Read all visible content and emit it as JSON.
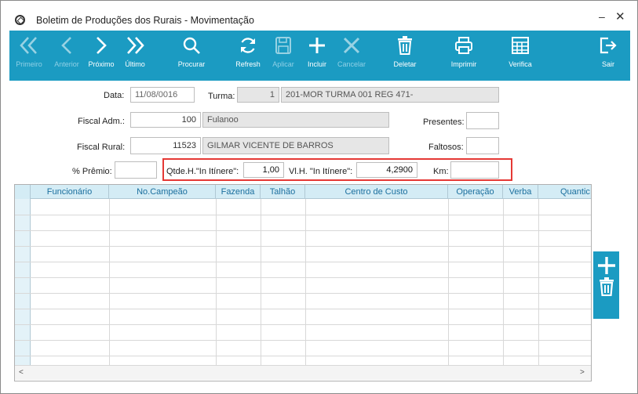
{
  "window": {
    "title": "Boletim de Produções dos Rurais - Movimentação"
  },
  "toolbar": {
    "first": "Primeiro",
    "previous": "Anterior",
    "next": "Próximo",
    "last": "Último",
    "search": "Procurar",
    "refresh": "Refresh",
    "apply": "Aplicar",
    "include": "Incluir",
    "cancel": "Cancelar",
    "delete": "Deletar",
    "print": "Imprimir",
    "verify": "Verifica",
    "exit": "Sair"
  },
  "form": {
    "data_label": "Data:",
    "data_value": "11/08/0016",
    "turma_label": "Turma:",
    "turma_code": "1",
    "turma_desc": "201-MOR TURMA 001 REG 471-",
    "fiscal_adm_label": "Fiscal Adm.:",
    "fiscal_adm_code": "100",
    "fiscal_adm_name": "Fulanoo",
    "presentes_label": "Presentes:",
    "presentes_value": "",
    "fiscal_rural_label": "Fiscal Rural:",
    "fiscal_rural_code": "11523",
    "fiscal_rural_name": "GILMAR VICENTE DE BARROS",
    "faltosos_label": "Faltosos:",
    "faltosos_value": "",
    "premio_label": "% Prêmio:",
    "premio_value": "",
    "qtde_label": "Qtde.H.\"In Itínere\":",
    "qtde_value": "1,00",
    "vlh_label": "Vl.H. \"In Itínere\":",
    "vlh_value": "4,2900",
    "km_label": "Km:",
    "km_value": ""
  },
  "grid": {
    "columns": [
      "Funcionário",
      "No.Campeão",
      "Fazenda",
      "Talhão",
      "Centro de Custo",
      "Operação",
      "Verba",
      "Quantic"
    ]
  },
  "colors": {
    "accent": "#1b9bc2",
    "highlight": "#e53935"
  }
}
